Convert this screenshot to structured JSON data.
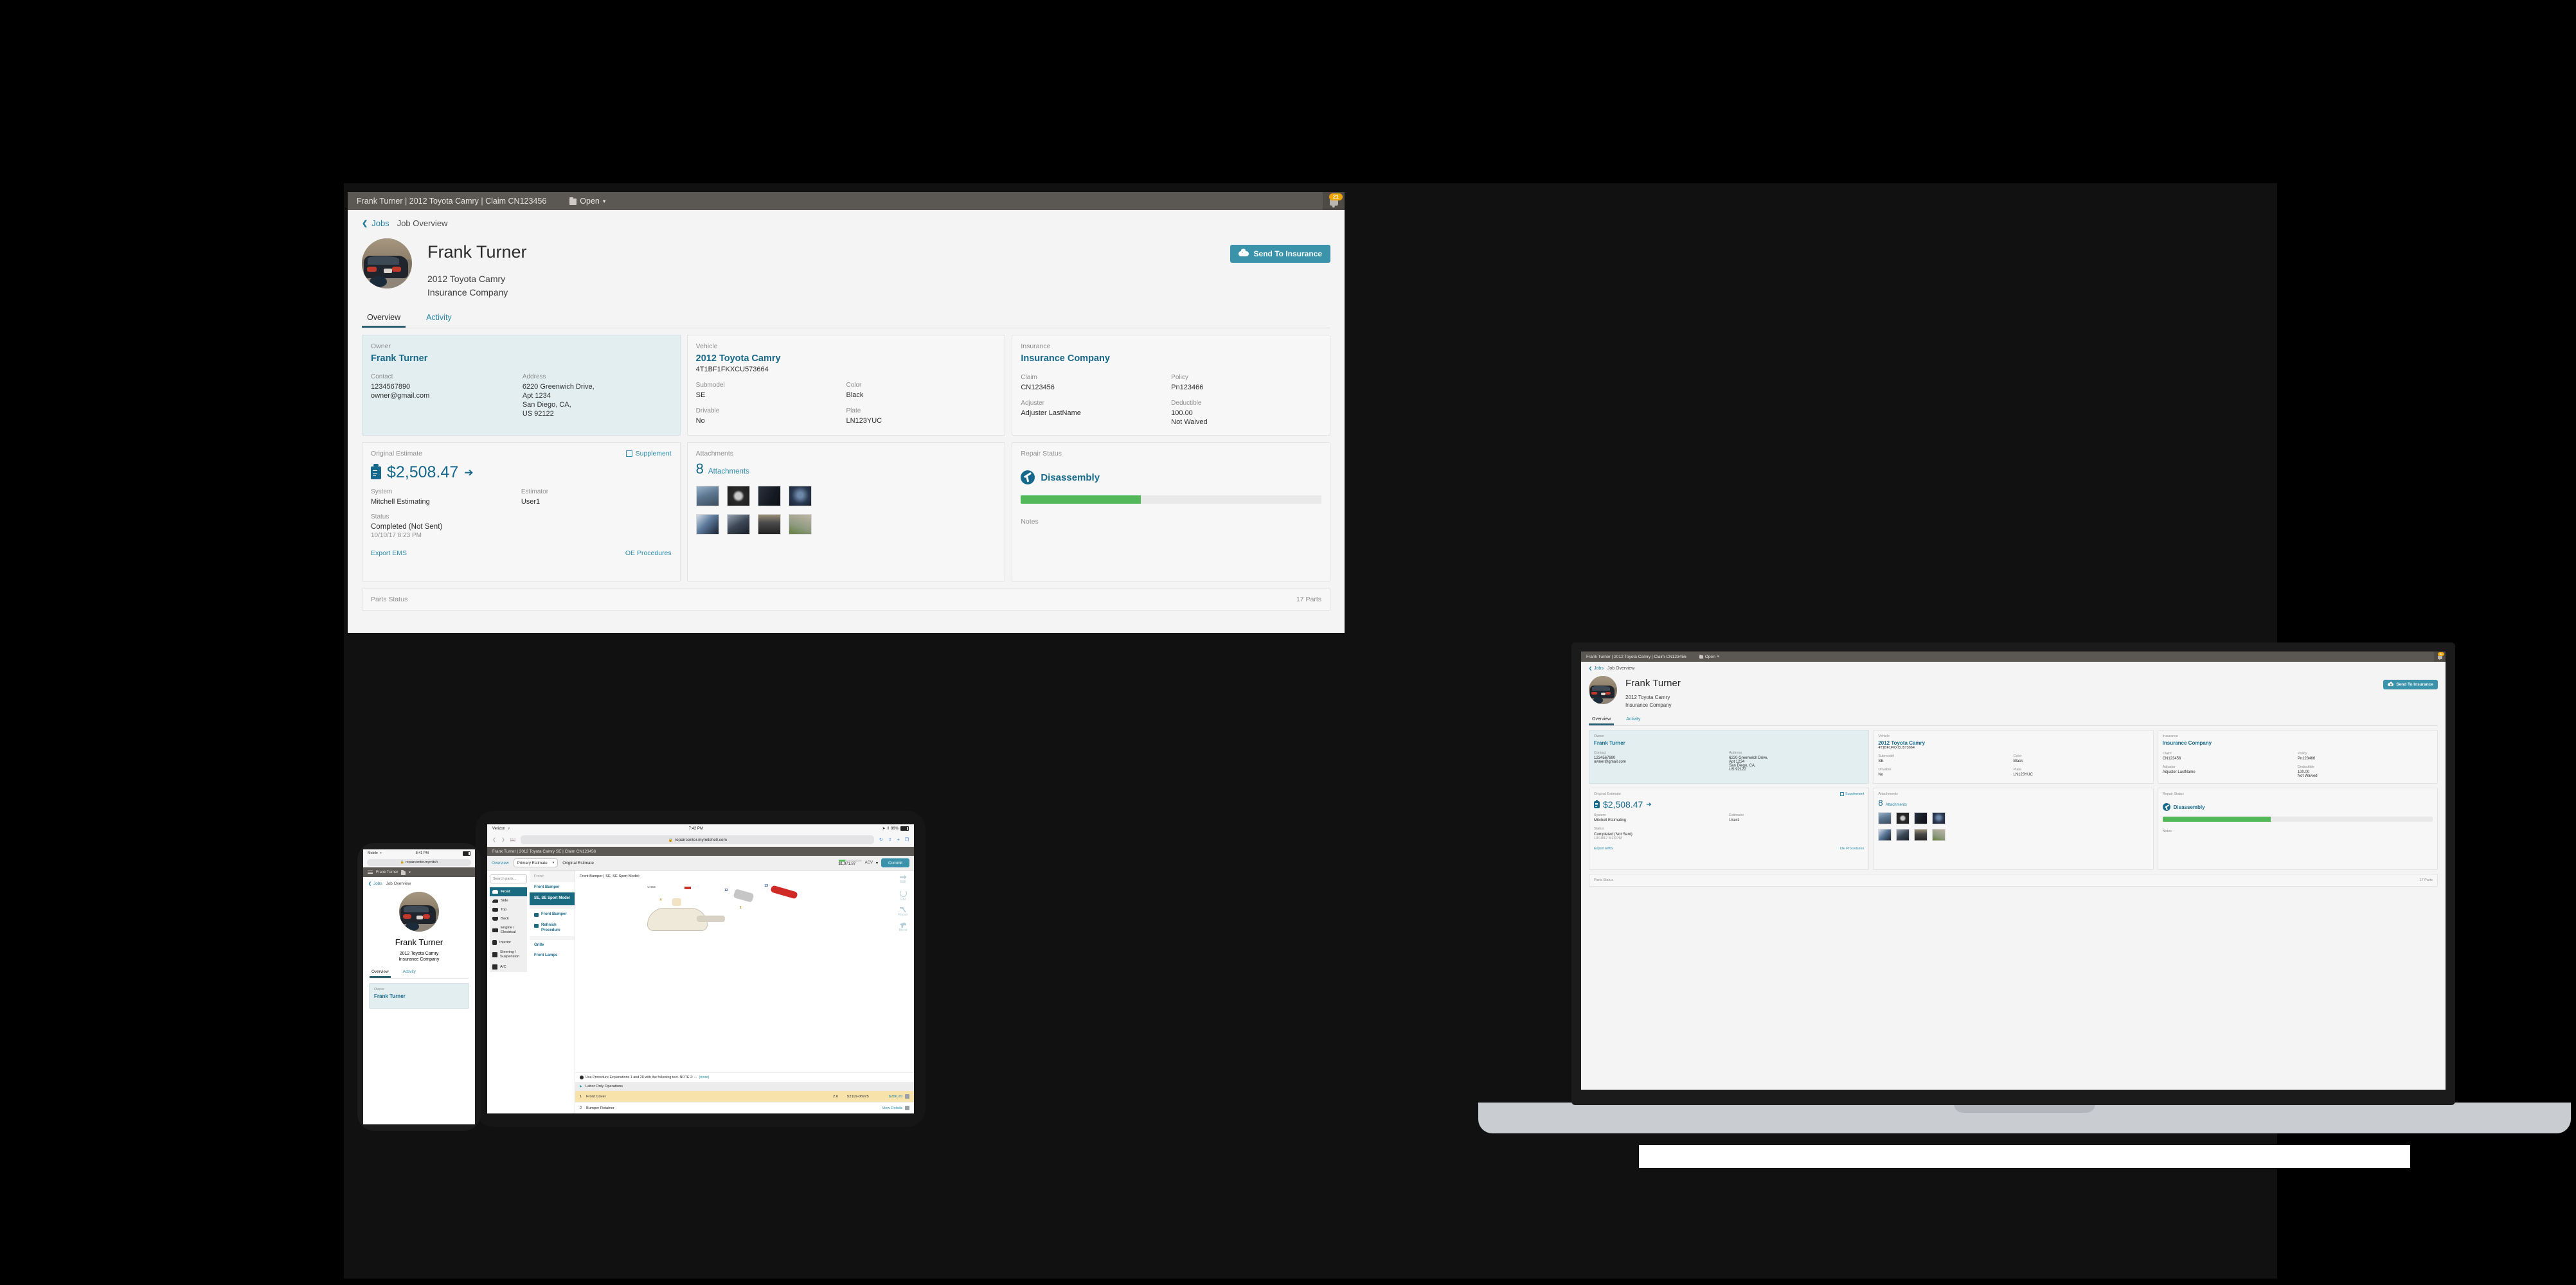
{
  "app": {
    "topbar": {
      "title": "Frank Turner | 2012 Toyota Camry | Claim CN123456",
      "open_label": "Open",
      "caret": "▾",
      "folder_icon": "folder-icon",
      "bell_icon": "bell-icon",
      "notification_count": "21"
    },
    "breadcrumb": {
      "back_chevron": "❮",
      "back_label": "Jobs",
      "current": "Job Overview"
    },
    "hero": {
      "name": "Frank Turner",
      "vehicle": "2012 Toyota Camry",
      "insurer": "Insurance Company",
      "send_button": "Send To Insurance",
      "send_icon": "cloud-upload-icon"
    },
    "tabs": [
      {
        "label": "Overview",
        "active": true
      },
      {
        "label": "Activity",
        "active": false
      }
    ],
    "cards": {
      "owner": {
        "section": "Owner",
        "name": "Frank Turner",
        "contact_label": "Contact",
        "phone": "1234567890",
        "email": "owner@gmail.com",
        "address_label": "Address",
        "address_lines": [
          "6220 Greenwich Drive,",
          "Apt 1234",
          "San Diego, CA,",
          "US 92122"
        ]
      },
      "vehicle": {
        "section": "Vehicle",
        "name": "2012 Toyota Camry",
        "vin": "4T1BF1FKXCU573664",
        "fields": [
          {
            "label": "Submodel",
            "value": "SE"
          },
          {
            "label": "Color",
            "value": "Black"
          },
          {
            "label": "Drivable",
            "value": "No"
          },
          {
            "label": "Plate",
            "value": "LN123YUC"
          }
        ]
      },
      "insurance": {
        "section": "Insurance",
        "name": "Insurance Company",
        "fields": [
          {
            "label": "Claim",
            "value": "CN123456"
          },
          {
            "label": "Policy",
            "value": "Pn123466"
          },
          {
            "label": "Adjuster",
            "value": "Adjuster LastName"
          },
          {
            "label": "Deductible",
            "value": "100.00",
            "value2": "Not Waived"
          }
        ]
      },
      "estimate": {
        "section": "Original Estimate",
        "supplement_label": "Supplement",
        "supplement_icon": "edit-square-icon",
        "clipboard_icon": "clipboard-lock-icon",
        "amount": "$2,508.47",
        "arrow": "➔",
        "system_label": "System",
        "system_value": "Mitchell Estimating",
        "estimator_label": "Estimator",
        "estimator_value": "User1",
        "status_label": "Status",
        "status_value": "Completed (Not Sent)",
        "status_date": "10/10/17 8:23 PM",
        "export_label": "Export EMS",
        "oe_label": "OE Procedures"
      },
      "attachments": {
        "section": "Attachments",
        "count": "8",
        "count_label": "Attachments",
        "thumbs": [
          "car-door-thumb",
          "wheel-thumb",
          "dashboard-thumb",
          "steering-wheel-thumb",
          "gauge-cluster-thumb",
          "engine-bay-thumb",
          "rear-car-thumb",
          "hood-thumb"
        ]
      },
      "repair": {
        "section": "Repair Status",
        "status": "Disassembly",
        "status_icon": "hammer-circle-icon",
        "progress_percent": 40,
        "notes_label": "Notes"
      },
      "parts": {
        "section": "Parts Status",
        "count": "17 Parts"
      }
    }
  },
  "tablet": {
    "ios": {
      "carrier": "Verizon",
      "wifi_icon": "wifi-icon",
      "time": "7:42 PM",
      "location_icon": "location-arrow-icon",
      "bluetooth_icon": "bluetooth-icon",
      "battery": "86%",
      "battery_icon": "battery-icon",
      "url": "repaircenter.mymitchell.com",
      "lock_icon": "lock-icon",
      "back_icon": "chevron-left-icon",
      "forward_icon": "chevron-right-icon",
      "bookmarks_icon": "book-icon",
      "reload_icon": "reload-icon",
      "share_icon": "share-icon",
      "new_tab_icon": "plus-icon",
      "tabs_icon": "tabs-icon"
    },
    "topbar_title": "Frank Turner | 2012 Toyota Camry SE | Claim CN123456",
    "nav_overview": "Overview",
    "estimate_select": "Primary Estimate",
    "estimate_caret": "▾",
    "estimate_name": "Original Estimate",
    "acv_label": "ACV",
    "acv_amount": "$1,971.87",
    "acv_caret": "▾",
    "commit_label": "Commit",
    "search_placeholder": "Search parts...",
    "nav_items": [
      {
        "label": "Front",
        "icon": "car-front-icon",
        "active": true
      },
      {
        "label": "Side",
        "icon": "car-side-icon",
        "active": false
      },
      {
        "label": "Top",
        "icon": "car-top-icon",
        "active": false
      },
      {
        "label": "Back",
        "icon": "car-back-icon",
        "active": false
      },
      {
        "label": "Engine / Electrical",
        "icon": "engine-icon",
        "active": false
      },
      {
        "label": "Interior",
        "icon": "seat-icon",
        "active": false
      },
      {
        "label": "Steering / Suspension",
        "icon": "suspension-icon",
        "active": false
      },
      {
        "label": "A/C",
        "icon": "ac-icon",
        "active": false
      }
    ],
    "part_col_head": "Front:",
    "part_items": [
      {
        "label": "Front Bumper",
        "selected": false
      },
      {
        "label": "SE, SE Sport Model",
        "selected": true
      }
    ],
    "part_books": [
      {
        "label": "Front Bumper",
        "icon": "book-icon"
      },
      {
        "label": "Refinish Procedure",
        "icon": "book-icon"
      }
    ],
    "part_more": [
      "Grille",
      "Front Lamps"
    ],
    "diagram_title": "Front Bumper | SE, SE Sport Model:",
    "diagram_legend": "UHSS",
    "diagram_labels": [
      "12",
      "13",
      "4",
      "1"
    ],
    "rail": [
      {
        "label": "R&R",
        "icon": "swap-arrows-icon"
      },
      {
        "label": "R&I",
        "icon": "circular-arrow-icon"
      },
      {
        "label": "Repair",
        "icon": "hammer-icon"
      },
      {
        "label": "Blend",
        "icon": "spray-gun-icon"
      }
    ],
    "note_text": "Use Procedure Explanations 1 and 28 with the following text. NOTE 2: ...",
    "note_more": "(more)",
    "note_icon": "globe-icon",
    "labor_row": "Labor Only Operations",
    "labor_caret": "▶",
    "table_rows": [
      {
        "num": "1",
        "name": "Front Cover",
        "hours": "2.6",
        "partno": "52119-06975",
        "price": "$286.29",
        "action": "",
        "highlight": true
      },
      {
        "num": "2",
        "name": "Bumper Retainer",
        "hours": "",
        "partno": "",
        "price": "",
        "action": "View Details",
        "highlight": false
      }
    ],
    "play_icon": "play-icon"
  },
  "phone": {
    "ios": {
      "carrier": "Mobile",
      "wifi_icon": "wifi-icon",
      "time": "8:41 PM",
      "battery_icon": "battery-icon",
      "url": "repaircenter.mymitch",
      "lock_icon": "lock-icon"
    },
    "menu_icon": "hamburger-icon",
    "topbar_title": "Frank Turner",
    "folder_icon": "folder-icon",
    "caret": "▾",
    "back_label": "Jobs",
    "current": "Job Overview",
    "name": "Frank Turner",
    "vehicle": "2012 Toyota Camry",
    "insurer": "Insurance Company",
    "tabs": [
      {
        "label": "Overview",
        "active": true
      },
      {
        "label": "Activity",
        "active": false
      }
    ],
    "owner_label": "Owner",
    "owner_name": "Frank Turner"
  },
  "colors": {
    "accent": "#16698a",
    "button": "#3a93ab",
    "topbar": "#5b5753",
    "owner_card": "#e2eef0",
    "progress": "#53b85a",
    "badge": "#f0a400",
    "highlight_row": "#f7e2ab"
  }
}
